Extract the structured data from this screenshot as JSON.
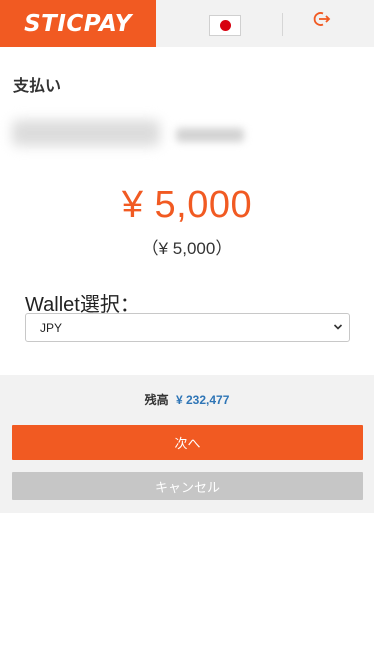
{
  "header": {
    "logo": "STICPAY",
    "language_flag": "japan-flag-icon",
    "logout_icon": "logout-icon",
    "brand_color": "#f15a22"
  },
  "page": {
    "title": "支払い"
  },
  "payment": {
    "amount": "¥ 5,000",
    "amount_converted": "（¥ 5,000）",
    "amount_color": "#f15a22"
  },
  "wallet": {
    "label": "Wallet選択：",
    "selected": "JPY"
  },
  "balance": {
    "label": "残高",
    "value": "¥ 232,477",
    "value_color": "#2e75b6"
  },
  "actions": {
    "next_label": "次へ",
    "cancel_label": "キャンセル"
  }
}
